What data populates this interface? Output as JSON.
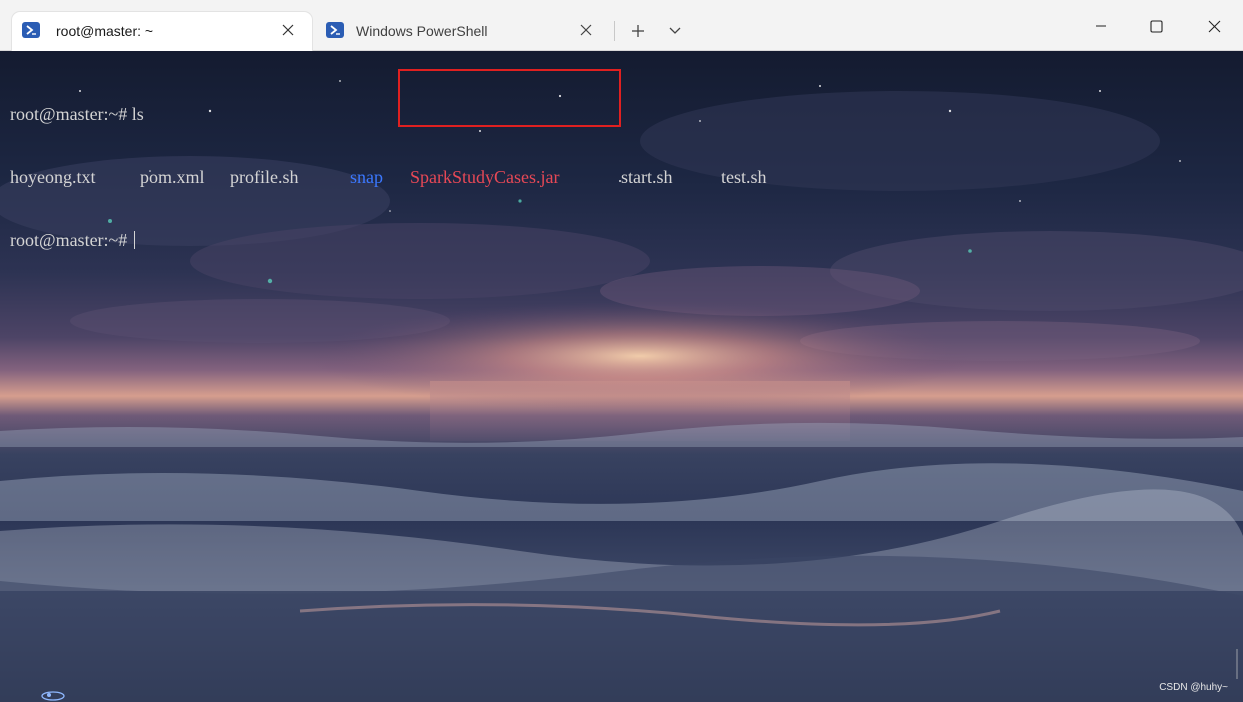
{
  "tabs": [
    {
      "title": "root@master: ~",
      "icon": "powershell-icon",
      "active": true
    },
    {
      "title": "Windows PowerShell",
      "icon": "powershell-icon",
      "active": false
    }
  ],
  "terminal": {
    "line1": {
      "prompt": "root@master:~# ",
      "command": "ls"
    },
    "listing": [
      {
        "name": "hoyeong.txt",
        "kind": "file"
      },
      {
        "name": "pom.xml",
        "kind": "file"
      },
      {
        "name": "profile.sh",
        "kind": "file"
      },
      {
        "name": "snap",
        "kind": "directory"
      },
      {
        "name": "SparkStudyCases.jar",
        "kind": "archive"
      },
      {
        "name": "start.sh",
        "kind": "file"
      },
      {
        "name": "test.sh",
        "kind": "file"
      }
    ],
    "line3": {
      "prompt": "root@master:~# "
    }
  },
  "watermark": "CSDN @huhy~",
  "colors": {
    "terminal_text": "#d4d4d4",
    "directory": "#3b78ff",
    "archive": "#e74856",
    "highlight_box": "#e02020",
    "titlebar": "#f3f3f3"
  }
}
